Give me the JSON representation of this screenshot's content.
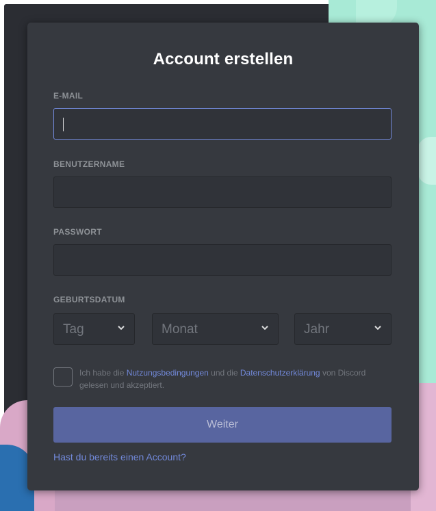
{
  "title": "Account erstellen",
  "email": {
    "label": "E-MAIL",
    "value": ""
  },
  "username": {
    "label": "BENUTZERNAME",
    "value": ""
  },
  "password": {
    "label": "PASSWORT",
    "value": ""
  },
  "birthdate": {
    "label": "GEBURTSDATUM",
    "day": "Tag",
    "month": "Monat",
    "year": "Jahr"
  },
  "terms": {
    "prefix": "Ich habe die ",
    "tos_link": "Nutzungsbedingungen",
    "middle": " und die ",
    "privacy_link": "Datenschutzerklärung",
    "suffix": " von Discord gelesen und akzeptiert."
  },
  "continue_label": "Weiter",
  "login_link": "Hast du bereits einen Account?",
  "colors": {
    "accent": "#7289da",
    "card": "#36393f",
    "button": "#5865a0"
  }
}
